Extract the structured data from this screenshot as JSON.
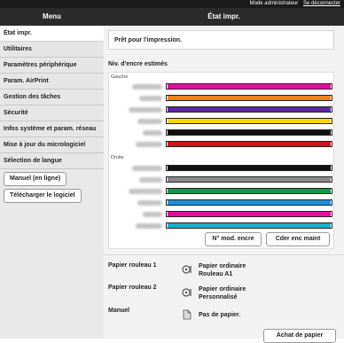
{
  "topbar": {
    "mode": "Mode administrateur",
    "logout": "Se déconnecter"
  },
  "header": {
    "menu": "Menu",
    "title": "État impr."
  },
  "sidebar": {
    "items": [
      {
        "label": "État impr."
      },
      {
        "label": "Utilitaires"
      },
      {
        "label": "Paramètres périphérique"
      },
      {
        "label": "Param. AirPrint"
      },
      {
        "label": "Gestion des tâches"
      },
      {
        "label": "Sécurité"
      },
      {
        "label": "Infos système et param. réseau"
      },
      {
        "label": "Mise à jour du micrologiciel"
      },
      {
        "label": "Sélection de langue"
      }
    ],
    "manual_button": "Manuel (en ligne)",
    "download_button": "Télécharger le logiciel"
  },
  "main": {
    "status": "Prêt pour l'impression.",
    "ink_title": "Niv. d'encre estimés",
    "left_label": "Gauche",
    "right_label": "Droite",
    "ink_left": [
      {
        "color": "#e0109e",
        "level": 1.0
      },
      {
        "color": "#f08018",
        "level": 1.0
      },
      {
        "color": "#5a2aa0",
        "level": 1.0
      },
      {
        "color": "#f5d800",
        "level": 1.0
      },
      {
        "color": "#111111",
        "level": 1.0
      },
      {
        "color": "#d0141e",
        "level": 1.0
      }
    ],
    "ink_right": [
      {
        "color": "#111111",
        "level": 1.0
      },
      {
        "color": "#888888",
        "level": 1.0
      },
      {
        "color": "#109848",
        "level": 1.0
      },
      {
        "color": "#2090d8",
        "level": 1.0
      },
      {
        "color": "#e0109e",
        "level": 1.0
      },
      {
        "color": "#18b0c8",
        "level": 1.0
      }
    ],
    "ink_model_button": "N° mod. encre",
    "order_ink_button": "Cder enc maint",
    "paper": [
      {
        "label": "Papier rouleau 1",
        "line1": "Papier ordinaire",
        "line2": "Rouleau A1",
        "icon": "roll-icon"
      },
      {
        "label": "Papier rouleau 2",
        "line1": "Papier ordinaire",
        "line2": "Personnalisé",
        "icon": "roll-icon"
      },
      {
        "label": "Manuel",
        "line1": "Pas de papier.",
        "line2": "",
        "icon": "sheet-icon"
      }
    ],
    "buy_paper_button": "Achat de papier"
  }
}
